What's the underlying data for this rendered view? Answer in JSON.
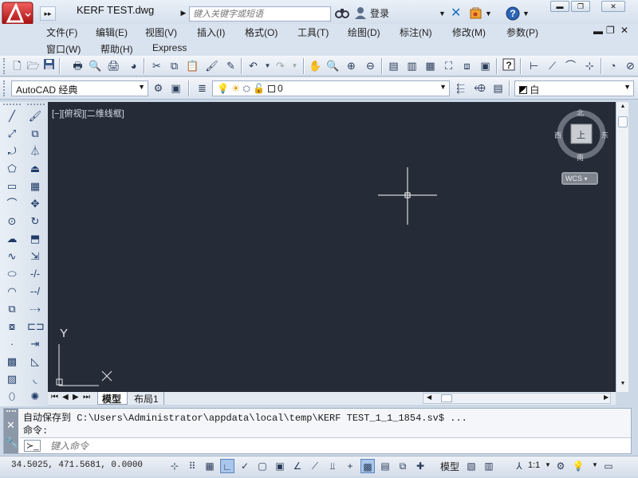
{
  "title_bar": {
    "logo_letter": "A",
    "document_title": "KERF TEST.dwg",
    "search_placeholder": "键入关键字或短语",
    "login_label": "登录",
    "icons": [
      "binoculars-icon",
      "user-icon",
      "exchange-icon",
      "app-store-icon",
      "help-icon"
    ],
    "window_buttons": [
      "minimize",
      "restore",
      "close"
    ]
  },
  "menu": {
    "row1": [
      "文件(F)",
      "编辑(E)",
      "视图(V)",
      "插入(I)",
      "格式(O)",
      "工具(T)",
      "绘图(D)",
      "标注(N)",
      "修改(M)",
      "参数(P)"
    ],
    "row2": [
      "窗口(W)",
      "帮助(H)",
      "Express"
    ]
  },
  "toolbar2": {
    "workspace": "AutoCAD 经典",
    "layer_value": "0",
    "color_value": "白"
  },
  "viewport": {
    "label": "[−][俯视][二维线框]",
    "viewcube": {
      "north": "北",
      "south": "南",
      "east": "东",
      "west": "西",
      "top": "上"
    },
    "wcs": "WCS",
    "ucs_y": "Y",
    "ucs_x": "X"
  },
  "layout_tabs": [
    "模型",
    "布局1"
  ],
  "command": {
    "history_line1": "自动保存到 C:\\Users\\Administrator\\appdata\\local\\temp\\KERF TEST_1_1_1854.sv$ ...",
    "history_line2": "命令:",
    "input_placeholder": "键入命令"
  },
  "status_bar": {
    "coordinates": "34.5025, 471.5681, 0.0000",
    "model_label": "模型",
    "annotation_scale": "1:1"
  }
}
